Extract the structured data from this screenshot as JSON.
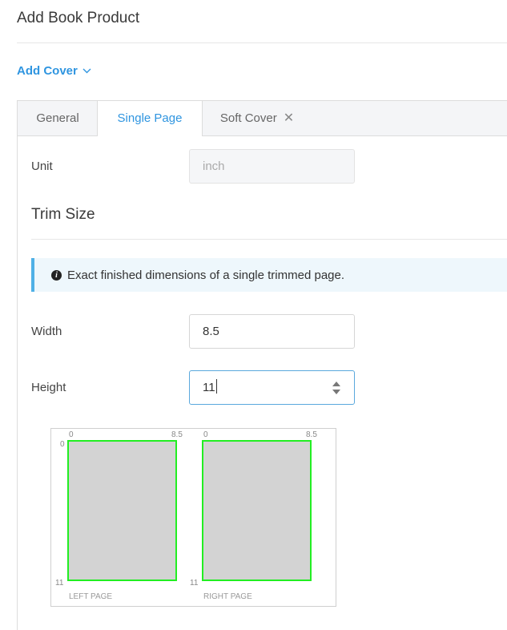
{
  "header": {
    "title": "Add Book Product"
  },
  "add_cover": {
    "label": "Add Cover"
  },
  "tabs": {
    "general": "General",
    "single_page": "Single Page",
    "soft_cover": "Soft Cover"
  },
  "form": {
    "unit_label": "Unit",
    "unit_value": "inch",
    "trim_size_title": "Trim Size",
    "info_text": "Exact finished dimensions of a single trimmed page.",
    "width_label": "Width",
    "width_value": "8.5",
    "height_label": "Height",
    "height_value": "11"
  },
  "preview": {
    "left": {
      "x_start": "0",
      "x_end": "8.5",
      "y_start": "0",
      "y_end": "11",
      "caption": "LEFT PAGE"
    },
    "right": {
      "x_start": "0",
      "x_end": "8.5",
      "y_end": "11",
      "caption": "RIGHT PAGE"
    }
  },
  "colors": {
    "accent": "#2f95e0",
    "trim_outline": "#22ee22",
    "page_fill": "#d3d3d3",
    "info_bg": "#eef7fc",
    "info_border": "#4fb0e6"
  },
  "icons": {
    "add_cover": "chevron-down-icon",
    "tab_close": "close-icon",
    "info": "info-icon",
    "spinner": "spinner-icon"
  }
}
